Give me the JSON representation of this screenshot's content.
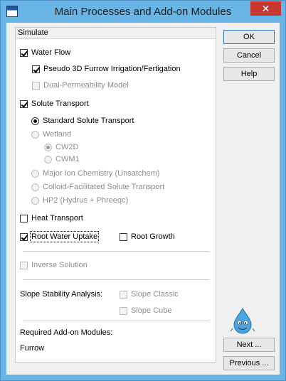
{
  "window": {
    "title": "Main Processes and Add-on Modules",
    "close_glyph": "✕"
  },
  "group": {
    "title": "Simulate"
  },
  "water_flow": {
    "label": "Water Flow",
    "checked": true
  },
  "pseudo_3d": {
    "label": "Pseudo 3D Furrow Irrigation/Fertigation",
    "checked": true
  },
  "dual_perm": {
    "label": "Dual-Permeability Model",
    "checked": false
  },
  "solute_transport": {
    "label": "Solute Transport",
    "checked": true
  },
  "standard_solute": {
    "label": "Standard Solute Transport",
    "selected": true
  },
  "wetland": {
    "label": "Wetland"
  },
  "cw2d": {
    "label": "CW2D",
    "selected": true
  },
  "cwm1": {
    "label": "CWM1"
  },
  "major_ion": {
    "label": "Major Ion Chemistry (Unsatchem)"
  },
  "colloid": {
    "label": "Colloid-Facilitated Solute Transport"
  },
  "hp2": {
    "label": "HP2 (Hydrus + Phreeqc)"
  },
  "heat_transport": {
    "label": "Heat Transport",
    "checked": false
  },
  "root_water_uptake": {
    "label": "Root Water Uptake",
    "checked": true
  },
  "root_growth": {
    "label": "Root Growth",
    "checked": false
  },
  "inverse_solution": {
    "label": "Inverse Solution",
    "checked": false
  },
  "slope_stability": {
    "label": "Slope Stability Analysis:"
  },
  "slope_classic": {
    "label": "Slope Classic"
  },
  "slope_cube": {
    "label": "Slope Cube"
  },
  "required_addons": {
    "label": "Required Add-on Modules:",
    "value": "Furrow"
  },
  "buttons": {
    "ok": "OK",
    "cancel": "Cancel",
    "help": "Help",
    "next": "Next ...",
    "previous": "Previous ..."
  }
}
